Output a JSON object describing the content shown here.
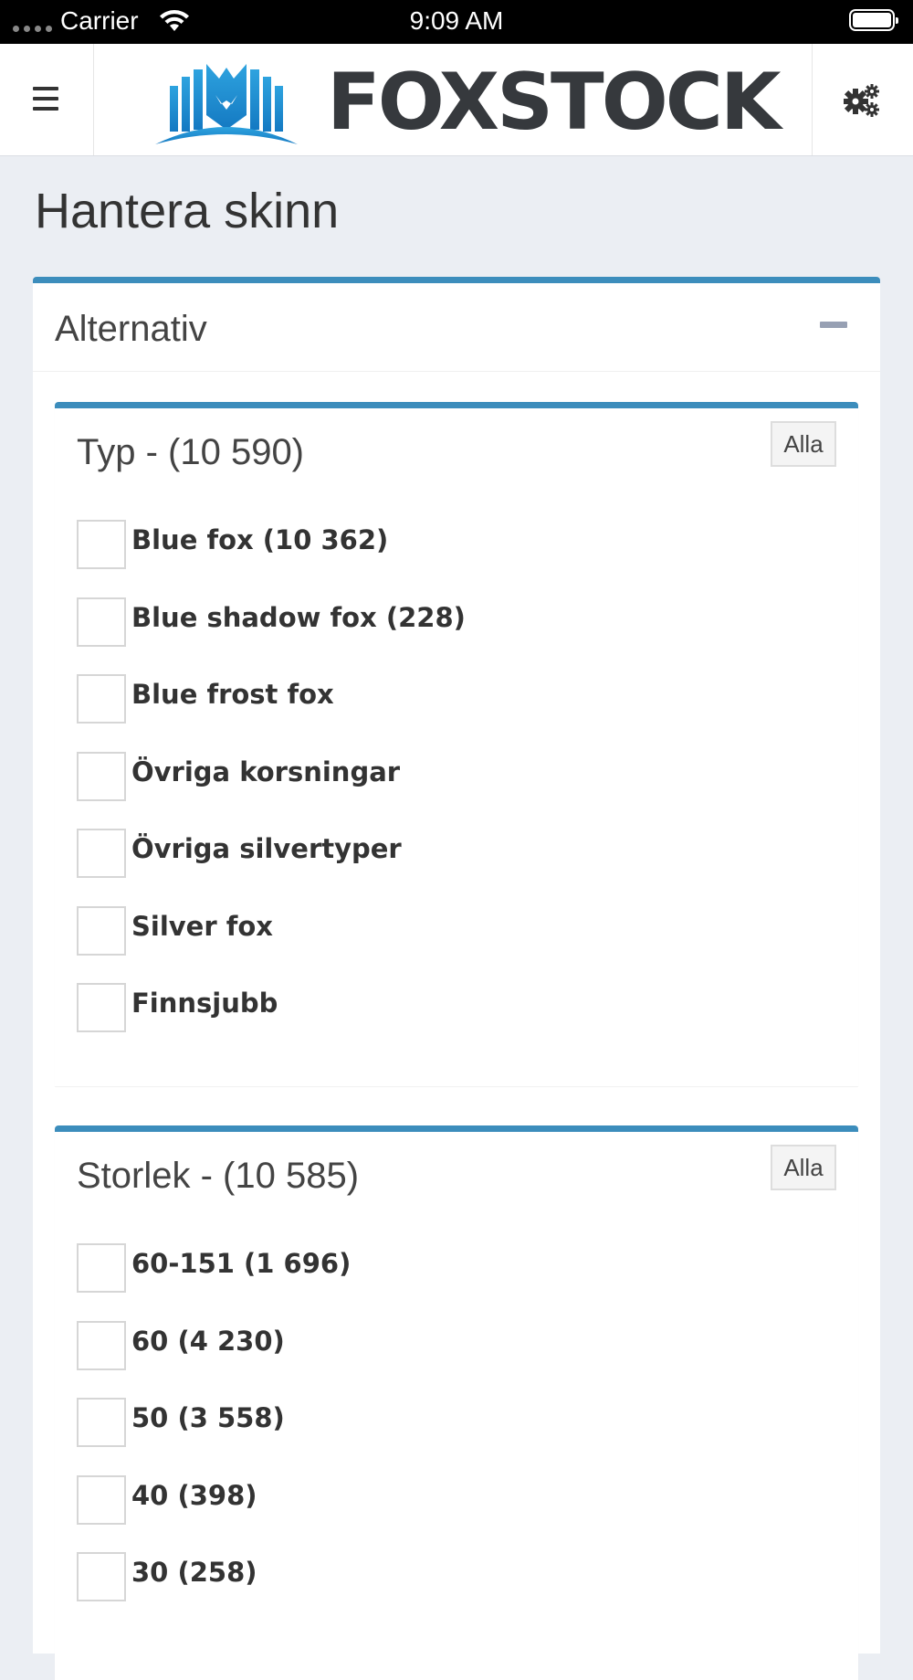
{
  "status_bar": {
    "carrier": "Carrier",
    "time": "9:09 AM"
  },
  "navbar": {
    "logo_text": "FOXSTOCK",
    "menu_icon": "hamburger-menu-icon",
    "settings_icon": "gears-icon"
  },
  "page": {
    "title": "Hantera skinn"
  },
  "options_box": {
    "title": "Alternativ",
    "collapse_icon": "minus-icon",
    "accent_color": "#3c8dbc",
    "filters": [
      {
        "title": "Typ - (10 590)",
        "all_label": "Alla",
        "options": [
          {
            "label": "Blue fox (10 362)",
            "checked": false
          },
          {
            "label": "Blue shadow fox (228)",
            "checked": false
          },
          {
            "label": "Blue frost fox",
            "checked": false
          },
          {
            "label": "Övriga korsningar",
            "checked": false
          },
          {
            "label": "Övriga silvertyper",
            "checked": false
          },
          {
            "label": "Silver fox",
            "checked": false
          },
          {
            "label": "Finnsjubb",
            "checked": false
          }
        ]
      },
      {
        "title": "Storlek - (10 585)",
        "all_label": "Alla",
        "options": [
          {
            "label": "60-151 (1 696)",
            "checked": false
          },
          {
            "label": "60 (4 230)",
            "checked": false
          },
          {
            "label": "50 (3 558)",
            "checked": false
          },
          {
            "label": "40 (398)",
            "checked": false
          },
          {
            "label": "30 (258)",
            "checked": false
          }
        ]
      }
    ]
  }
}
